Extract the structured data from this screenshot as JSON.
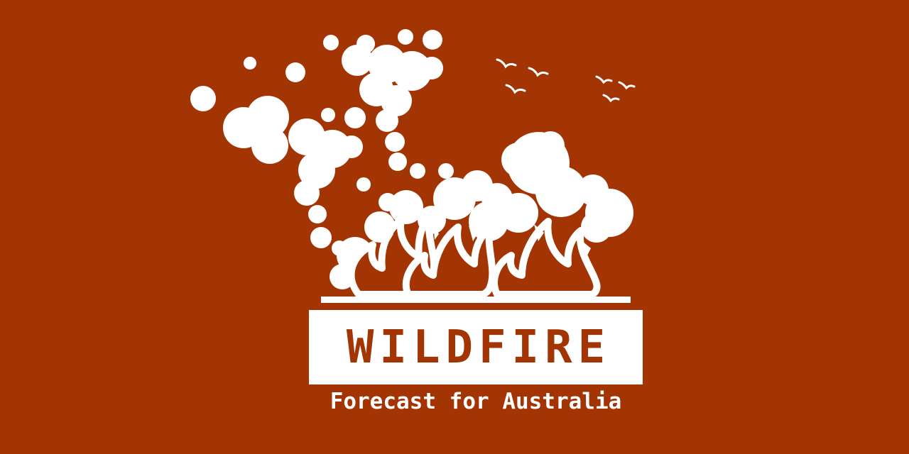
{
  "logo": {
    "title": "WILDFIRE",
    "subtitle": "Forecast for Australia"
  },
  "colors": {
    "background": "#a33403",
    "foreground": "#ffffff"
  },
  "icons": [
    "smoke-cloud-icon",
    "flames-icon",
    "birds-icon"
  ]
}
